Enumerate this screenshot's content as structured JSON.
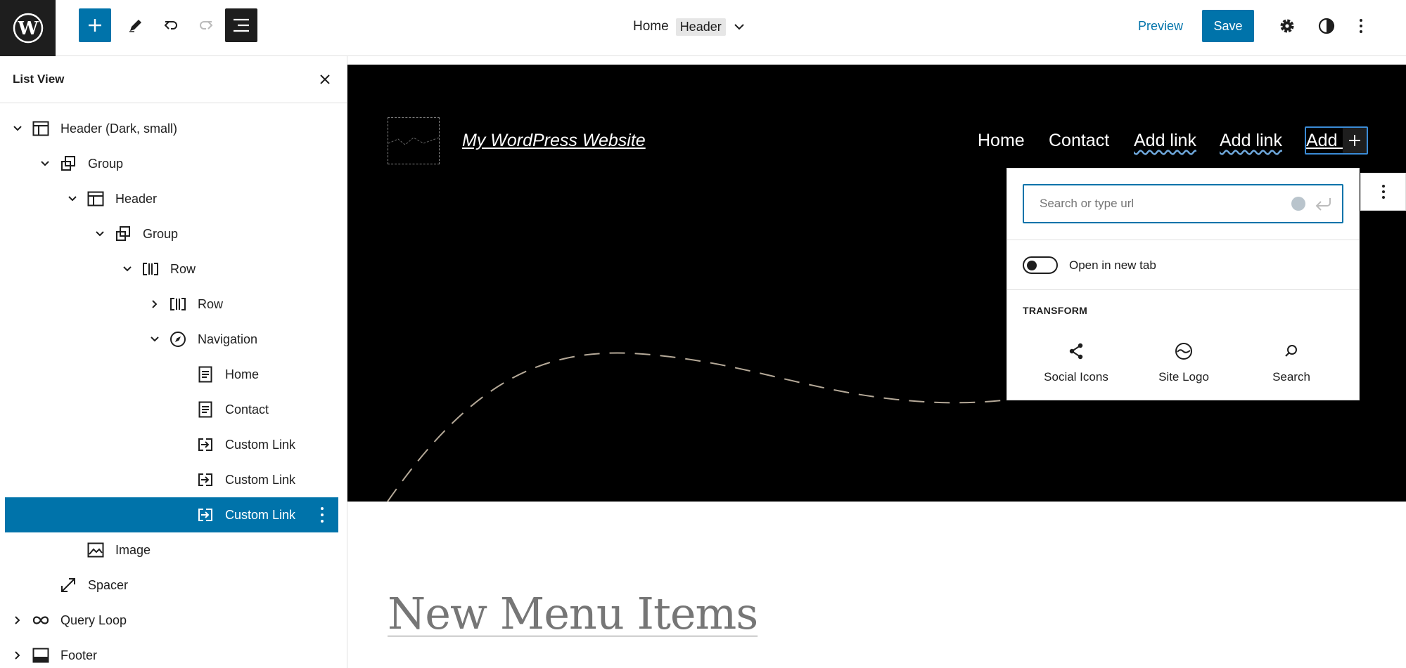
{
  "toolbar": {
    "doc_title": "Home",
    "doc_badge": "Header",
    "preview_label": "Preview",
    "save_label": "Save",
    "icons": [
      "wordpress-logo-icon",
      "plus-icon",
      "pencil-icon",
      "undo-icon",
      "redo-icon",
      "list-view-icon",
      "chevron-down-icon",
      "gear-icon",
      "contrast-icon",
      "more-vertical-icon"
    ]
  },
  "sidebar": {
    "title": "List View",
    "items": [
      {
        "label": "Header (Dark, small)",
        "icon": "template-part-icon",
        "chevron": "down"
      },
      {
        "label": "Group",
        "icon": "group-icon",
        "chevron": "down"
      },
      {
        "label": "Header",
        "icon": "template-part-icon",
        "chevron": "down"
      },
      {
        "label": "Group",
        "icon": "group-icon",
        "chevron": "down"
      },
      {
        "label": "Row",
        "icon": "row-icon",
        "chevron": "down"
      },
      {
        "label": "Row",
        "icon": "row-icon",
        "chevron": "right"
      },
      {
        "label": "Navigation",
        "icon": "compass-icon",
        "chevron": "down"
      },
      {
        "label": "Home",
        "icon": "page-icon",
        "chevron": ""
      },
      {
        "label": "Contact",
        "icon": "page-icon",
        "chevron": ""
      },
      {
        "label": "Custom Link",
        "icon": "custom-link-icon",
        "chevron": ""
      },
      {
        "label": "Custom Link",
        "icon": "custom-link-icon",
        "chevron": ""
      },
      {
        "label": "Custom Link",
        "icon": "custom-link-icon",
        "chevron": "",
        "selected": true
      },
      {
        "label": "Image",
        "icon": "image-icon",
        "chevron": ""
      },
      {
        "label": "Spacer",
        "icon": "resize-icon",
        "chevron": ""
      },
      {
        "label": "Query Loop",
        "icon": "loop-icon",
        "chevron": "right"
      },
      {
        "label": "Footer",
        "icon": "footer-icon",
        "chevron": "right"
      }
    ]
  },
  "canvas": {
    "site_title": "My WordPress Website",
    "nav_items": [
      "Home",
      "Contact",
      "Add link",
      "Add link"
    ],
    "nav_active_partial": "Add l",
    "heading": "New Menu Items"
  },
  "link_popover": {
    "search_placeholder": "Search or type url",
    "search_value": "",
    "toggle_label": "Open in new tab",
    "toggle_on": false,
    "transform_heading": "TRANSFORM",
    "transform_options": [
      {
        "label": "Social Icons",
        "icon": "share-icon"
      },
      {
        "label": "Site Logo",
        "icon": "site-logo-icon"
      },
      {
        "label": "Search",
        "icon": "search-icon"
      }
    ]
  },
  "colors": {
    "accent": "#0073aa",
    "dark": "#1e1e1e",
    "selection": "#0073aa",
    "curve": "#b5a998"
  }
}
